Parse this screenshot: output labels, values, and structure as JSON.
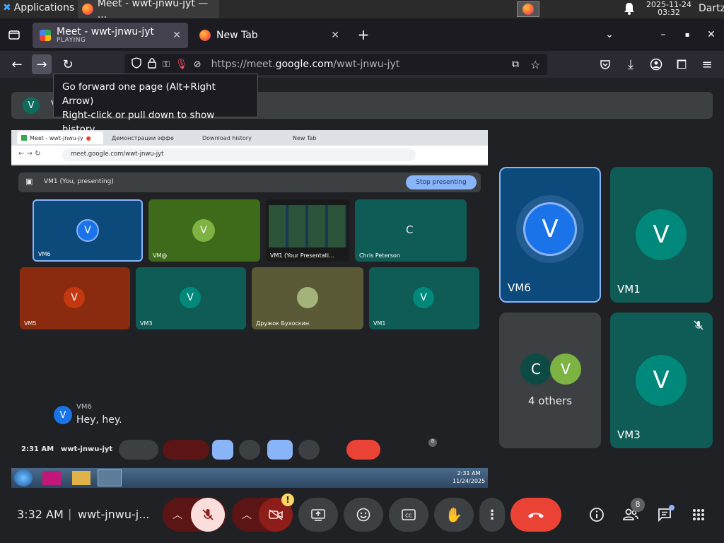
{
  "os": {
    "apps_label": "Applications",
    "apps_suffix": "☰",
    "task_title": "Meet - wwt-jnwu-jyt — ...",
    "clock_date": "2025-11-24",
    "clock_time": "03:32",
    "user": "Dartz"
  },
  "browser": {
    "tabs": [
      {
        "title": "Meet - wwt-jnwu-jyt",
        "sub": "PLAYING"
      },
      {
        "title": "New Tab",
        "sub": ""
      }
    ],
    "url_prefix": "https://meet.",
    "url_domain": "google.com",
    "url_path": "/wwt-jnwu-jyt",
    "tooltip_line1": "Go forward one page (Alt+Right Arrow)",
    "tooltip_line2": "Right-click or pull down to show history"
  },
  "notice": {
    "avatar_letter": "V",
    "text": "V"
  },
  "presentation": {
    "inner_tabs": [
      "Meet - wwt-jnwu-jy",
      "Демонстрации эффе",
      "Download history",
      "New Tab"
    ],
    "inner_url": "meet.google.com/wwt-jnwu-jyt",
    "presenting_label": "VM1 (You, presenting)",
    "stop_label": "Stop presenting",
    "tiles": [
      {
        "name": "VM6",
        "letter": "V"
      },
      {
        "name": "VM@",
        "letter": "V"
      },
      {
        "name": "VM1 (Your Presentati...",
        "letter": ""
      },
      {
        "name": "Chris Peterson",
        "letter": "C"
      },
      {
        "name": "VM5",
        "letter": "V"
      },
      {
        "name": "VM3",
        "letter": "V"
      },
      {
        "name": "Дружок Бухоскин",
        "letter": ""
      },
      {
        "name": "VM1",
        "letter": "V"
      }
    ],
    "chat_sender": "VM6",
    "chat_message": "Hey, hey.",
    "chat_avatar": "V",
    "inner_time": "2:31 AM",
    "inner_code": "wwt-jnwu-jyt",
    "inner_people_count": "8",
    "taskbar_time": "2:31 AM",
    "taskbar_date": "11/24/2025"
  },
  "tiles": [
    {
      "name": "VM6",
      "letter": "V"
    },
    {
      "name": "VM1",
      "letter": "V"
    },
    {
      "name": "4 others",
      "letters": [
        "C",
        "V"
      ]
    },
    {
      "name": "VM3",
      "letter": "V"
    }
  ],
  "bottom": {
    "time": "3:32 AM",
    "separator": "|",
    "code": "wwt-jnwu-j...",
    "people_count": "8",
    "camera_badge": "!"
  },
  "colors": {
    "accent_blue": "#8ab4f8",
    "end_call_red": "#ea4335",
    "tile_green": "#0f5b55",
    "vm6_blue": "#0b4a7a"
  }
}
